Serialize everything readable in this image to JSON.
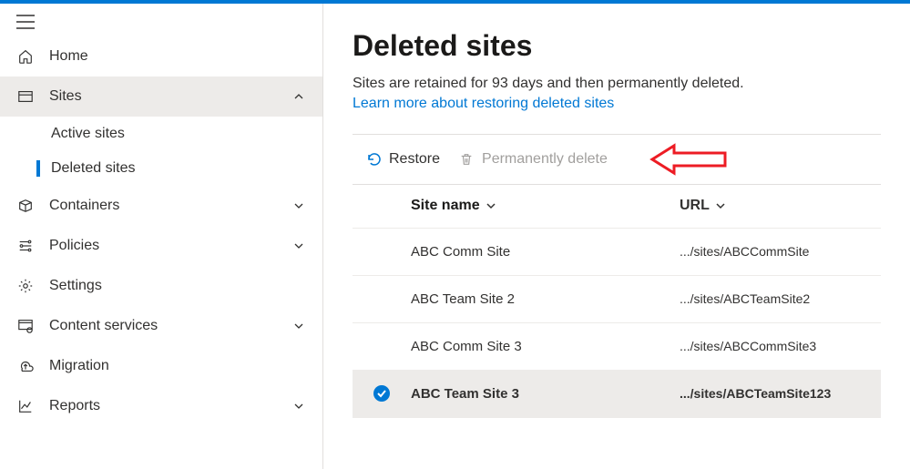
{
  "sidebar": {
    "items": {
      "home": "Home",
      "sites": "Sites",
      "sites_children": {
        "active": "Active sites",
        "deleted": "Deleted sites"
      },
      "containers": "Containers",
      "policies": "Policies",
      "settings": "Settings",
      "content_services": "Content services",
      "migration": "Migration",
      "reports": "Reports"
    }
  },
  "page": {
    "title": "Deleted sites",
    "description": "Sites are retained for 93 days and then permanently deleted.",
    "link": "Learn more about restoring deleted sites"
  },
  "toolbar": {
    "restore": "Restore",
    "perm_delete": "Permanently delete"
  },
  "table": {
    "columns": {
      "name": "Site name",
      "url": "URL"
    },
    "rows": [
      {
        "name": "ABC Comm Site",
        "url": ".../sites/ABCCommSite",
        "selected": false
      },
      {
        "name": "ABC Team Site 2",
        "url": ".../sites/ABCTeamSite2",
        "selected": false
      },
      {
        "name": "ABC Comm Site 3",
        "url": ".../sites/ABCCommSite3",
        "selected": false
      },
      {
        "name": "ABC Team Site 3",
        "url": ".../sites/ABCTeamSite123",
        "selected": true
      }
    ]
  }
}
